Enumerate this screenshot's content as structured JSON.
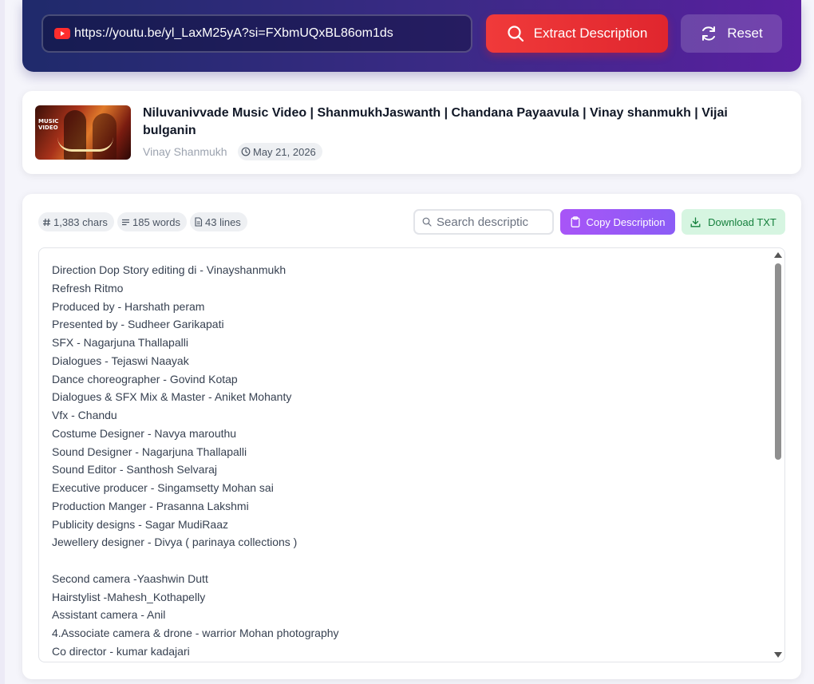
{
  "header": {
    "url_value": "https://youtu.be/yl_LaxM25yA?si=FXbmUQxBL86om1ds",
    "youtube_icon": "youtube-icon",
    "extract_label": "Extract Description",
    "extract_icon": "search-icon",
    "reset_label": "Reset",
    "reset_icon": "refresh-icon",
    "colors": {
      "extract": "#e0262e",
      "gradient_start": "#1f2a6b",
      "gradient_end": "#5a1fa0"
    }
  },
  "video": {
    "thumbnail_text": "MUSIC VIDEO",
    "title": "Niluvanivvade Music Video | ShanmukhJaswanth | Chandana Payaavula | Vinay shanmukh | Vijai bulganin",
    "channel": "Vinay Shanmukh",
    "date": "May 21, 2026",
    "date_icon": "clock-icon"
  },
  "stats": {
    "chars": "1,383 chars",
    "words": "185 words",
    "lines": "43 lines"
  },
  "toolbar": {
    "search_placeholder": "Search descriptic",
    "copy_label": "Copy Description",
    "copy_icon": "clipboard-icon",
    "download_label": "Download TXT",
    "download_icon": "download-icon",
    "colors": {
      "copy": "#a855f7",
      "download_bg": "#d6f5e1",
      "download_text": "#15803d"
    }
  },
  "description": {
    "lines": [
      "Direction Dop Story editing di - Vinayshanmukh",
      "Refresh Ritmo",
      "Produced by - Harshath peram",
      "Presented by - Sudheer Garikapati",
      "SFX - Nagarjuna Thallapalli",
      "Dialogues - Tejaswi Naayak",
      "Dance choreographer - Govind Kotap",
      "Dialogues & SFX Mix & Master - Aniket Mohanty",
      "Vfx - Chandu",
      "Costume Designer - Navya marouthu",
      "Sound Designer - Nagarjuna Thallapalli",
      "Sound Editor - Santhosh Selvaraj",
      "Executive producer - Singamsetty Mohan sai",
      "Production Manger - Prasanna Lakshmi",
      "Publicity designs - Sagar MudiRaaz",
      "Jewellery designer - Divya ( parinaya collections )",
      "",
      "Second camera -Yaashwin Dutt",
      "Hairstylist -Mahesh_Kothapelly",
      "Assistant camera - Anil",
      "4.Associate camera & drone - warrior Mohan photography",
      "Co director - kumar kadajari"
    ]
  }
}
